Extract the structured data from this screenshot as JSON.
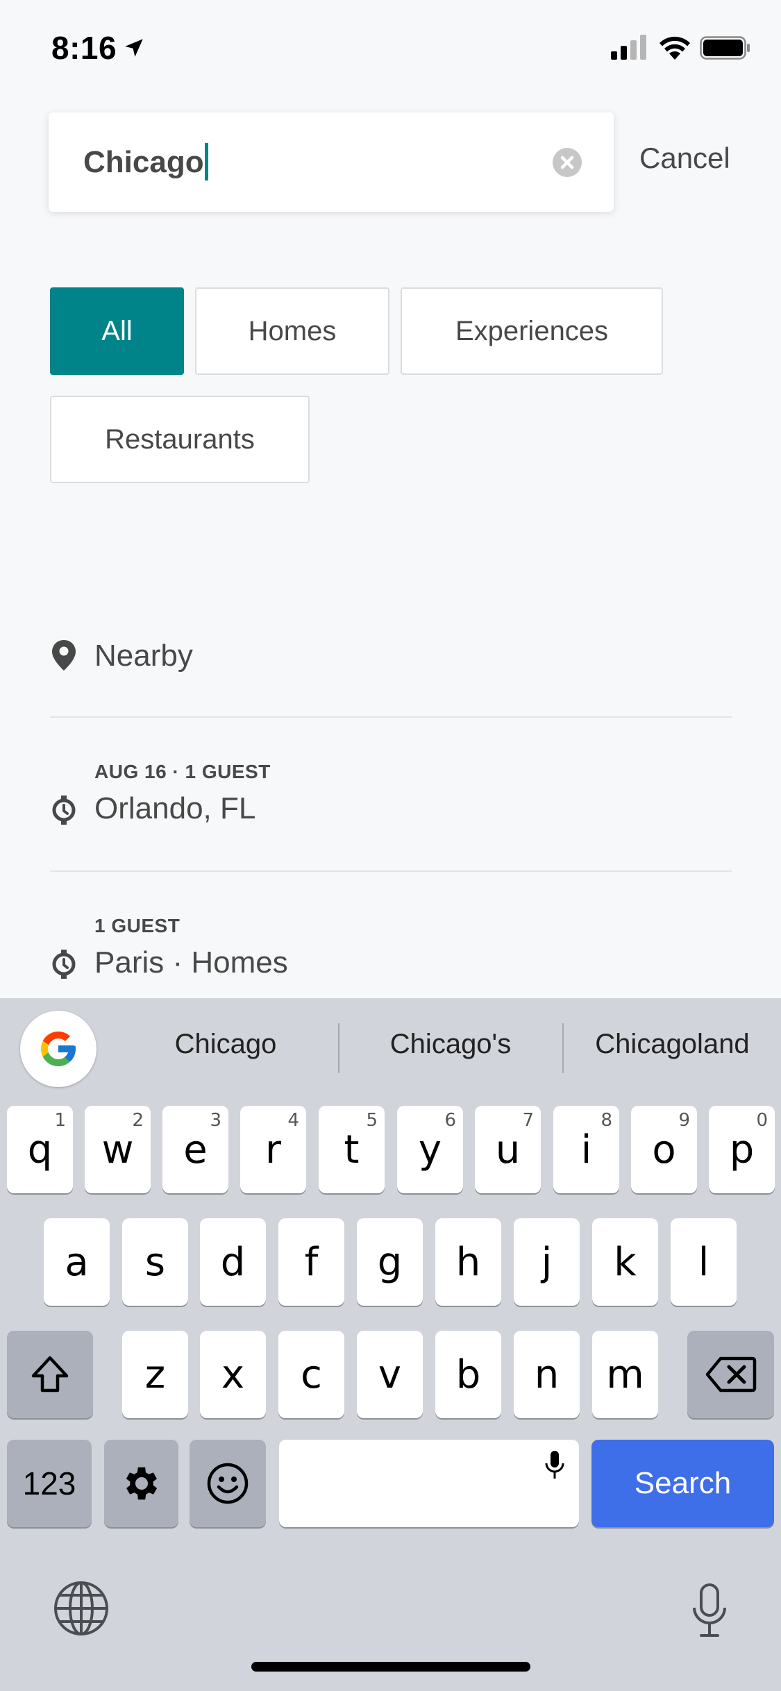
{
  "status_bar": {
    "time": "8:16"
  },
  "search": {
    "value": "Chicago",
    "cancel_label": "Cancel"
  },
  "filters": [
    {
      "label": "All",
      "active": true
    },
    {
      "label": "Homes",
      "active": false
    },
    {
      "label": "Experiences",
      "active": false
    },
    {
      "label": "Restaurants",
      "active": false
    }
  ],
  "recent": {
    "nearby": {
      "title": "Nearby",
      "icon": "location-pin-icon"
    },
    "items": [
      {
        "subtitle": "AUG 16 · 1 GUEST",
        "title": "Orlando, FL",
        "icon": "history-icon"
      },
      {
        "subtitle": "1 GUEST",
        "title": "Paris · Homes",
        "icon": "history-icon"
      }
    ]
  },
  "keyboard": {
    "suggestions": [
      "Chicago",
      "Chicago's",
      "Chicagoland"
    ],
    "row1": [
      {
        "k": "q",
        "h": "1"
      },
      {
        "k": "w",
        "h": "2"
      },
      {
        "k": "e",
        "h": "3"
      },
      {
        "k": "r",
        "h": "4"
      },
      {
        "k": "t",
        "h": "5"
      },
      {
        "k": "y",
        "h": "6"
      },
      {
        "k": "u",
        "h": "7"
      },
      {
        "k": "i",
        "h": "8"
      },
      {
        "k": "o",
        "h": "9"
      },
      {
        "k": "p",
        "h": "0"
      }
    ],
    "row2": [
      "a",
      "s",
      "d",
      "f",
      "g",
      "h",
      "j",
      "k",
      "l"
    ],
    "row3": [
      "z",
      "x",
      "c",
      "v",
      "b",
      "n",
      "m"
    ],
    "numbers_label": "123",
    "search_label": "Search",
    "accent_color": "#3e6ee8"
  },
  "colors": {
    "accent": "#008489",
    "text": "#484848",
    "background": "#f7f8f9"
  }
}
